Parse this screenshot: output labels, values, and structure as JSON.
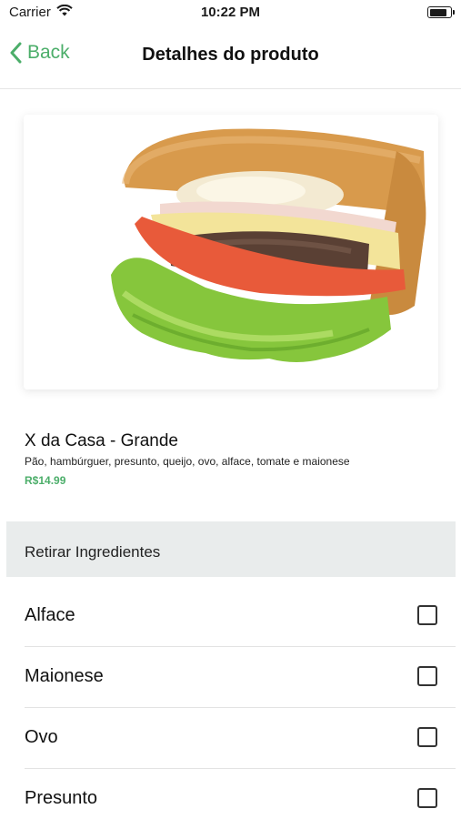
{
  "status_bar": {
    "carrier": "Carrier",
    "time": "10:22 PM",
    "wifi_icon": "wifi-icon",
    "battery_icon": "battery-icon"
  },
  "nav": {
    "back_label": "Back",
    "back_icon": "chevron-left-icon",
    "title": "Detalhes do produto"
  },
  "product": {
    "image": "burger-photo",
    "name": "X da Casa - Grande",
    "description": "Pão, hambúrguer, presunto, queijo, ovo, alface, tomate e maionese",
    "price": "R$14.99"
  },
  "section": {
    "title": "Retirar Ingredientes"
  },
  "ingredients": [
    {
      "label": "Alface",
      "checked": false
    },
    {
      "label": "Maionese",
      "checked": false
    },
    {
      "label": "Ovo",
      "checked": false
    },
    {
      "label": "Presunto",
      "checked": false
    }
  ],
  "colors": {
    "accent": "#4cae6a",
    "section_bg": "#e9ecec"
  }
}
